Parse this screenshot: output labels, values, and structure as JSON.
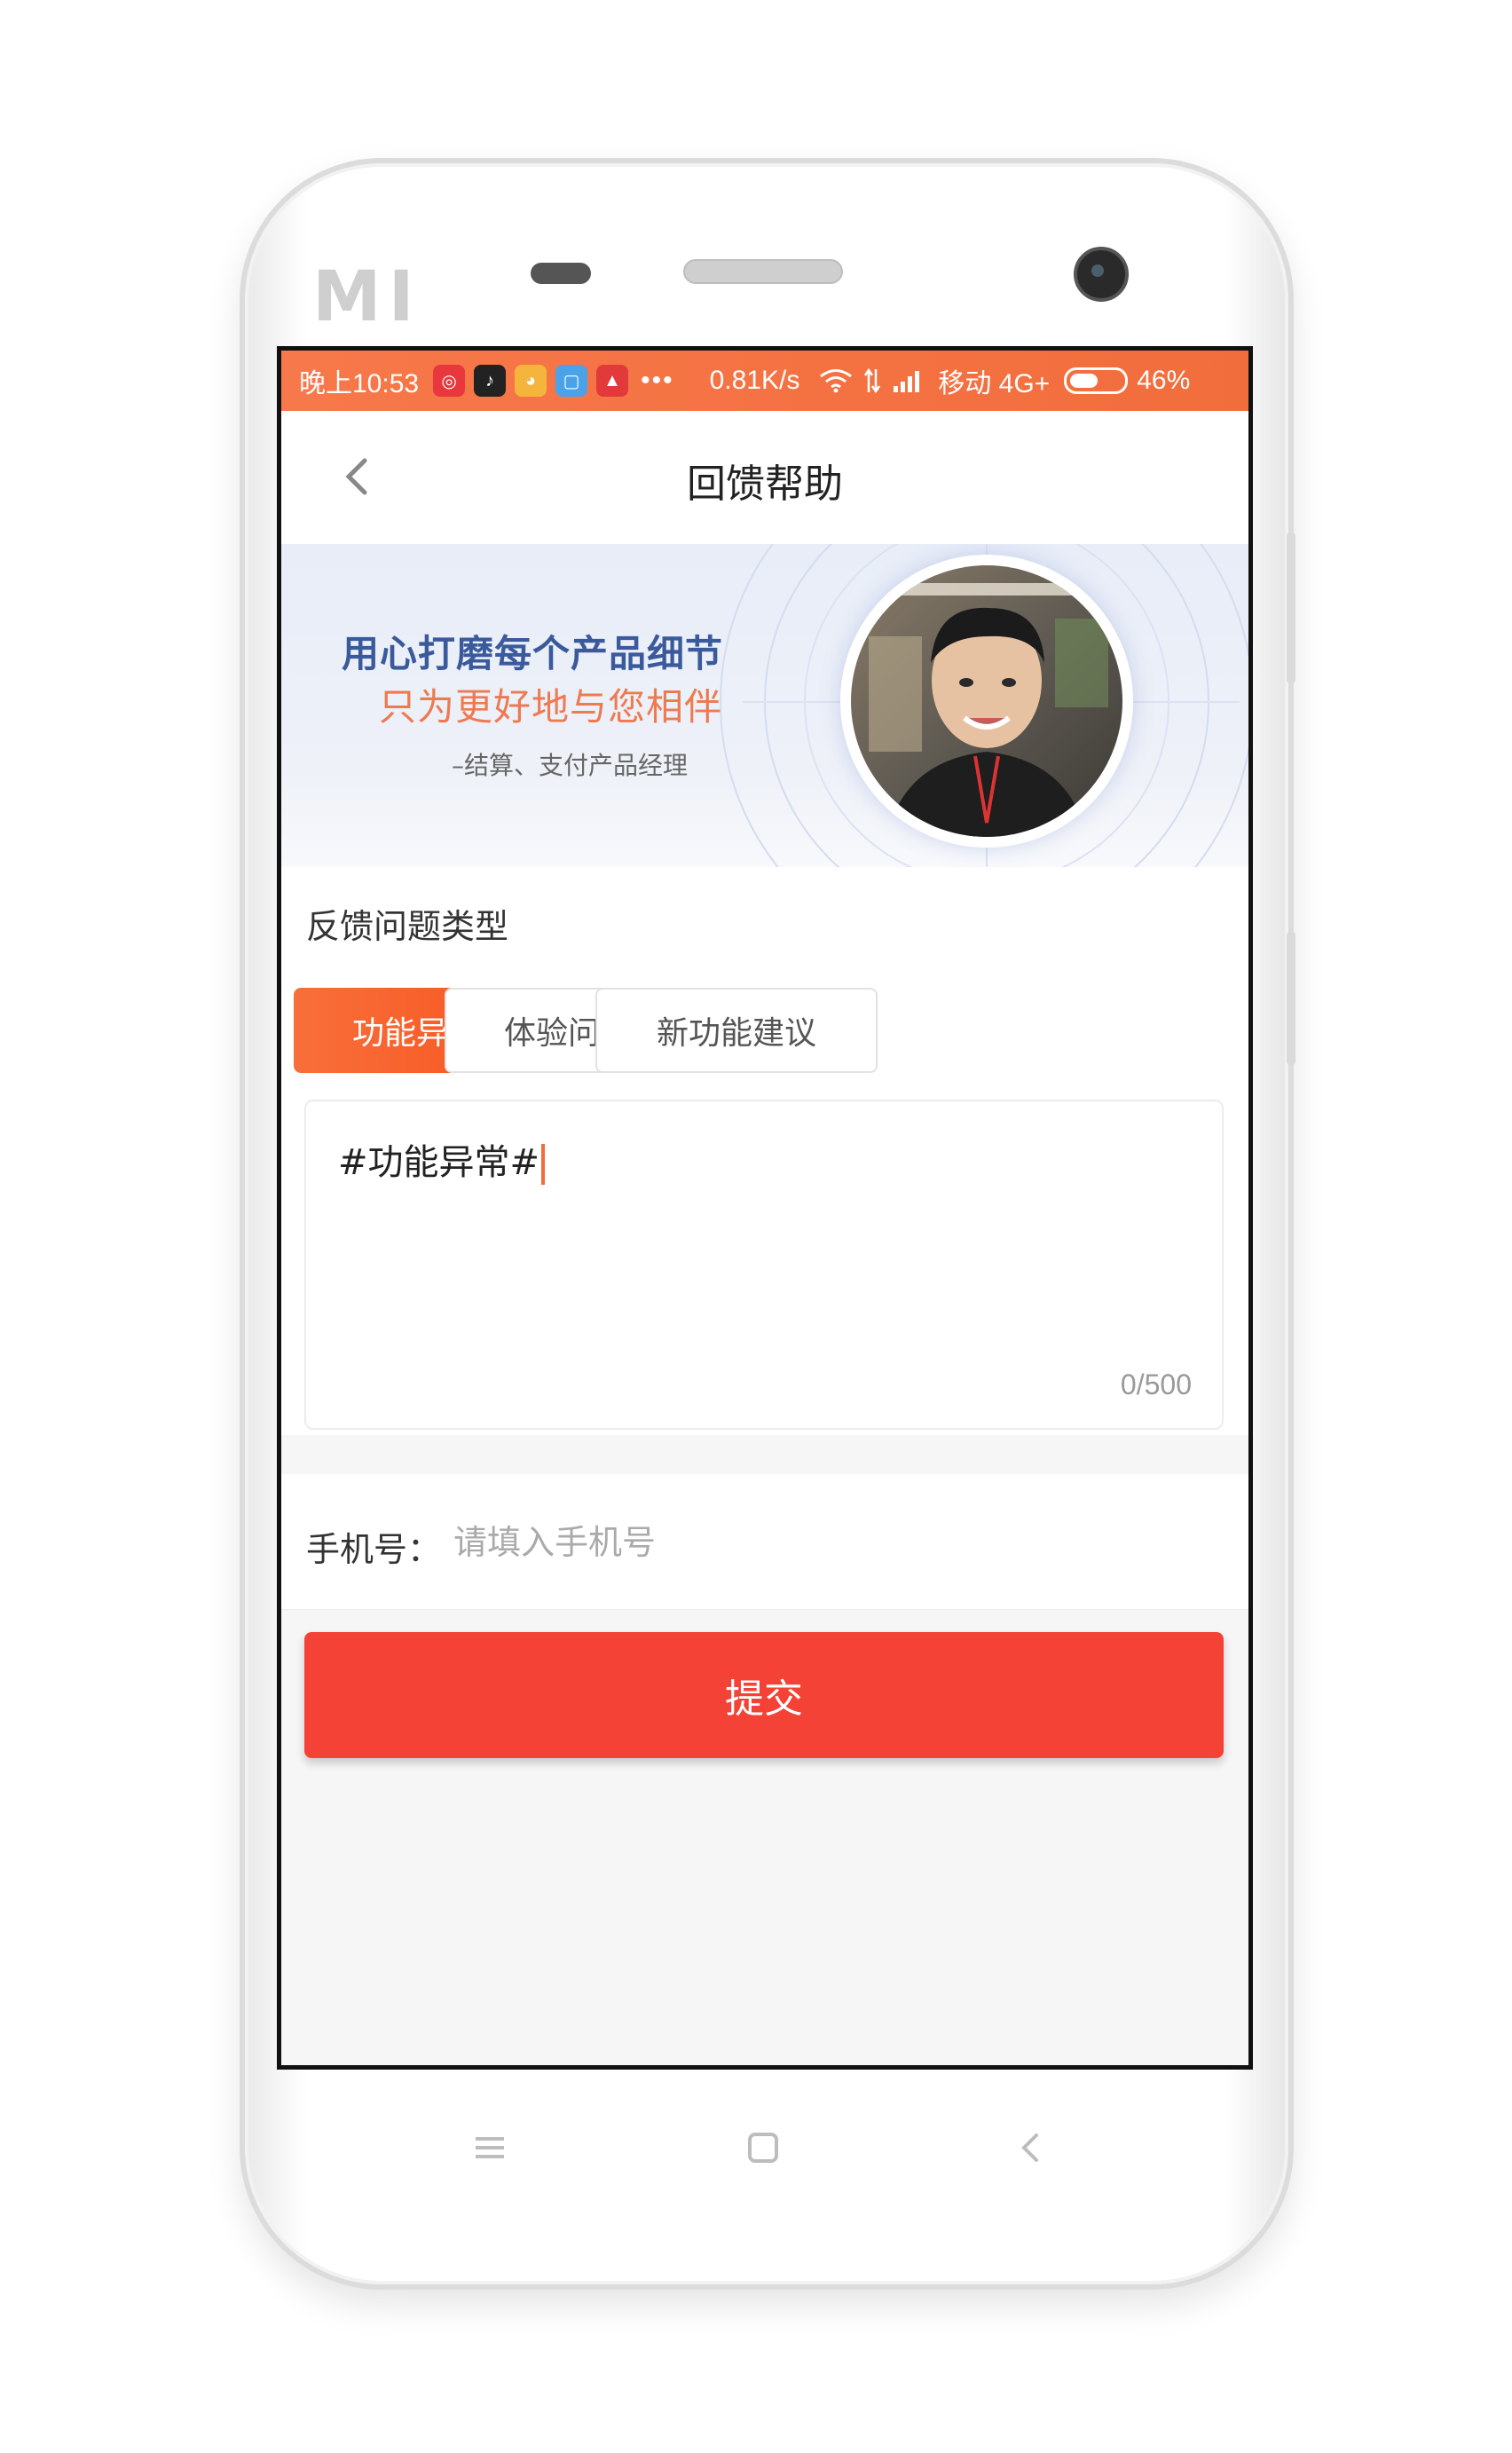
{
  "status_bar": {
    "time": "晚上10:53",
    "speed": "0.81K/s",
    "carrier": "移动 4G+",
    "battery_pct": "46%",
    "battery_level": 0.46,
    "app_icons": [
      "netease-music-icon",
      "tiktok-icon",
      "qq-icon",
      "chat-icon",
      "jd-icon"
    ]
  },
  "nav": {
    "title": "回馈帮助"
  },
  "banner": {
    "line1": "用心打磨每个产品细节",
    "line2": "只为更好地与您相伴",
    "line3": "–结算、支付产品经理"
  },
  "feedback": {
    "type_label": "反馈问题类型",
    "types": [
      "功能异常",
      "体验问题",
      "新功能建议"
    ],
    "selected_type": "功能异常",
    "text_value": "#功能异常#",
    "char_count": "0/500"
  },
  "phone": {
    "label": "手机号：",
    "placeholder": "请填入手机号",
    "value": ""
  },
  "submit_label": "提交",
  "colors": {
    "accent": "#f26d3c",
    "submit": "#f44336",
    "banner_blue": "#3a5a9c",
    "banner_orange": "#ee7a52"
  }
}
